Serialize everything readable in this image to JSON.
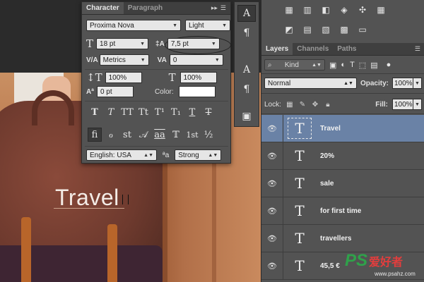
{
  "character_panel": {
    "tabs": [
      "Character",
      "Paragraph"
    ],
    "menu_arrows": "▸▸",
    "font_family": "Proxima Nova",
    "font_style": "Light",
    "font_size": "18 pt",
    "leading": "7,5 pt",
    "kerning": "Metrics",
    "tracking": "0",
    "vertical_scale": "100%",
    "horizontal_scale": "100%",
    "baseline_shift": "0 pt",
    "color_label": "Color:",
    "color_value": "#ffffff",
    "type_buttons": [
      "T",
      "T",
      "TT",
      "Tt",
      "T¹",
      "T₁",
      "T",
      "T"
    ],
    "opentype_buttons": [
      "fi",
      "ℴ",
      "st",
      "𝒜",
      "aa",
      "𝕋",
      "1st",
      "½"
    ],
    "language": "English: USA",
    "aa_label": "ªa",
    "antialias": "Strong"
  },
  "tools_column": {
    "items": [
      "A",
      "¶",
      "A",
      "¶",
      "▣"
    ]
  },
  "layers_panel": {
    "tabs": [
      "Layers",
      "Channels",
      "Paths"
    ],
    "kind_label": "Kind",
    "blend_mode": "Normal",
    "opacity_label": "Opacity:",
    "opacity_value": "100%",
    "lock_label": "Lock:",
    "fill_label": "Fill:",
    "fill_value": "100%",
    "layers": [
      {
        "name": "Travel",
        "selected": true
      },
      {
        "name": "20%",
        "selected": false
      },
      {
        "name": "sale",
        "selected": false
      },
      {
        "name": "for first time",
        "selected": false
      },
      {
        "name": "travellers",
        "selected": false
      },
      {
        "name": "45,5 €",
        "selected": false
      }
    ]
  },
  "canvas": {
    "text_on_canvas": "Travel"
  },
  "watermark": {
    "brand": "PS",
    "chinese": "爱好者",
    "url": "www.psahz.com"
  }
}
